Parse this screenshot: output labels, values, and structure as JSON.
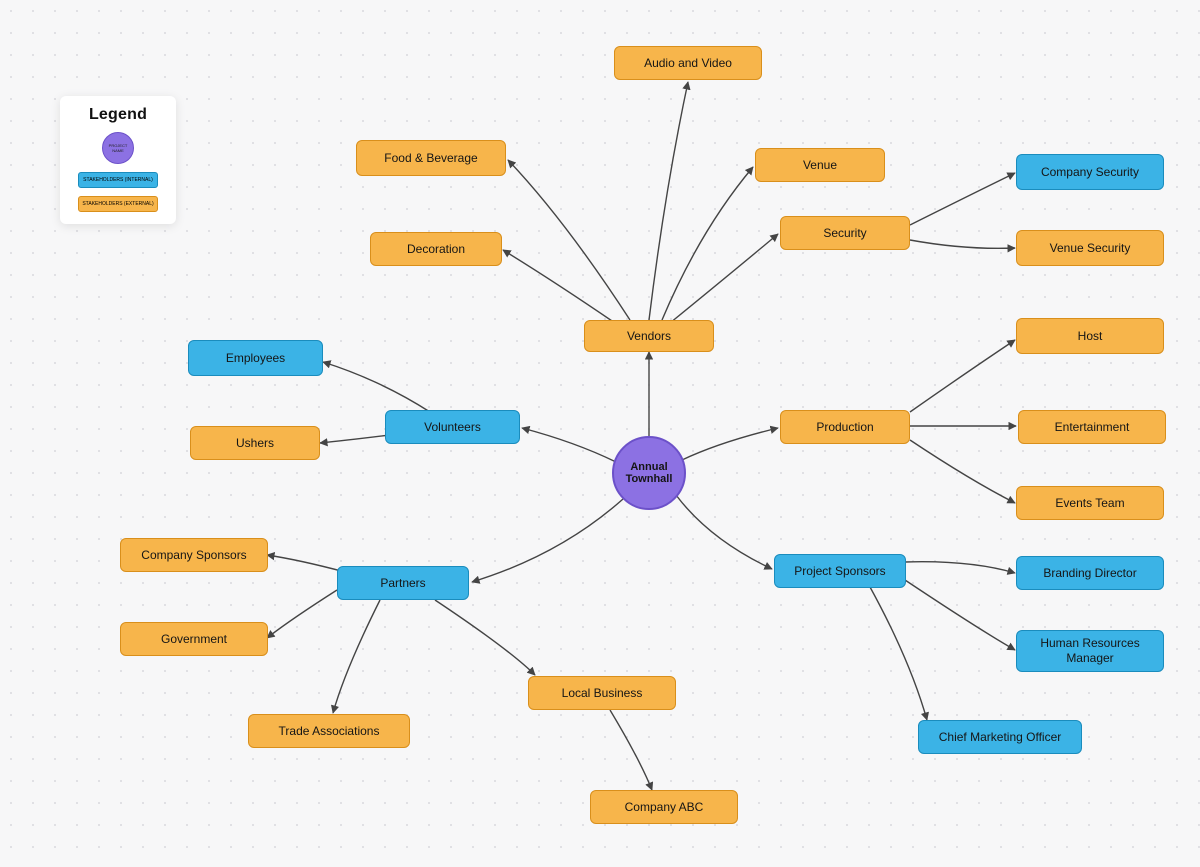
{
  "center": {
    "label": "Annual Townhall"
  },
  "legend": {
    "title": "Legend",
    "project": "PROJECT NAME",
    "internal": "STAKEHOLDERS (INTERNAL)",
    "external": "STAKEHOLDERS (EXTERNAL)"
  },
  "nodes": {
    "vendors": "Vendors",
    "food_beverage": "Food & Beverage",
    "audio_video": "Audio and Video",
    "venue": "Venue",
    "security": "Security",
    "company_security": "Company Security",
    "venue_security": "Venue Security",
    "decoration": "Decoration",
    "volunteers": "Volunteers",
    "employees": "Employees",
    "ushers": "Ushers",
    "production": "Production",
    "host": "Host",
    "entertainment": "Entertainment",
    "events_team": "Events Team",
    "project_sponsors": "Project Sponsors",
    "branding_director": "Branding Director",
    "hr_manager": "Human Resources Manager",
    "cmo": "Chief Marketing Officer",
    "partners": "Partners",
    "company_sponsors": "Company Sponsors",
    "government": "Government",
    "trade_assoc": "Trade Associations",
    "local_business": "Local Business",
    "company_abc": "Company ABC"
  }
}
